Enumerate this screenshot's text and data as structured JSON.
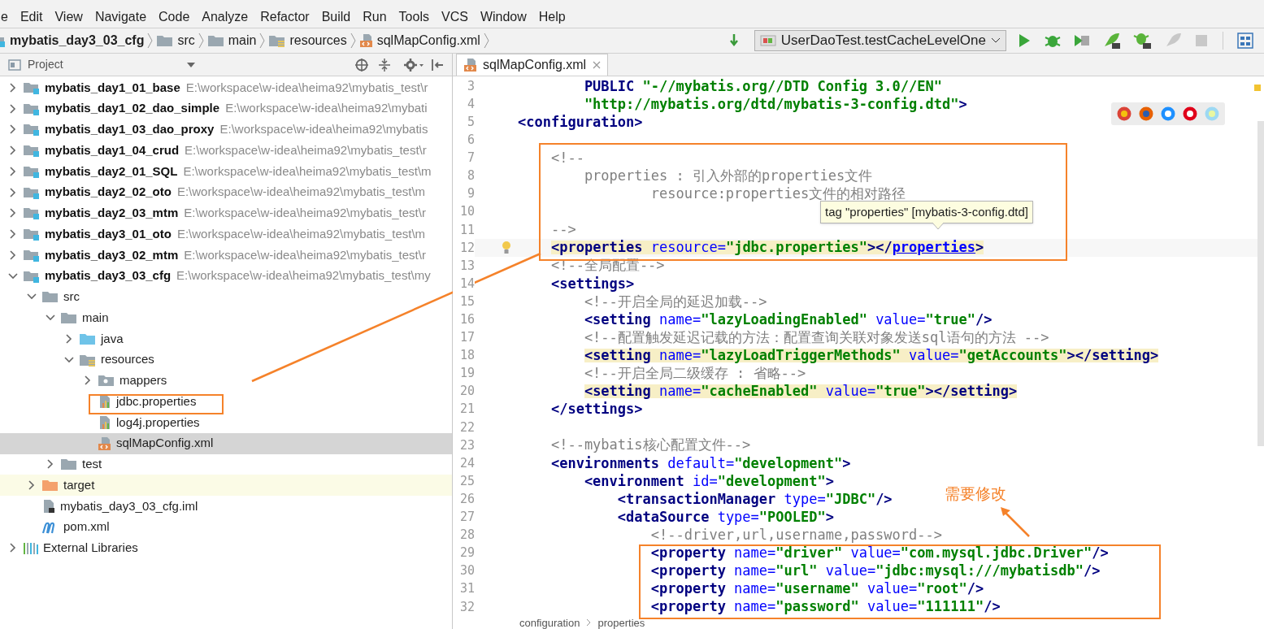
{
  "menu": [
    "e",
    "Edit",
    "View",
    "Navigate",
    "Code",
    "Analyze",
    "Refactor",
    "Build",
    "Run",
    "Tools",
    "VCS",
    "Window",
    "Help"
  ],
  "breadcrumbs": [
    {
      "label": "mybatis_day3_03_cfg",
      "kind": "module"
    },
    {
      "label": "src",
      "kind": "folder"
    },
    {
      "label": "main",
      "kind": "folder"
    },
    {
      "label": "resources",
      "kind": "resources-folder"
    },
    {
      "label": "sqlMapConfig.xml",
      "kind": "xml"
    }
  ],
  "run_config": "UserDaoTest.testCacheLevelOne",
  "project_panel": {
    "title": "Project",
    "tree": [
      {
        "label": "mybatis_day1_01_base",
        "path": "E:\\workspace\\w-idea\\heima92\\mybatis_test\\r",
        "kind": "module",
        "expanded": false,
        "selected": false
      },
      {
        "label": "mybatis_day1_02_dao_simple",
        "path": "E:\\workspace\\w-idea\\heima92\\mybati",
        "kind": "module",
        "expanded": false,
        "selected": false
      },
      {
        "label": "mybatis_day1_03_dao_proxy",
        "path": "E:\\workspace\\w-idea\\heima92\\mybatis",
        "kind": "module",
        "expanded": false,
        "selected": false
      },
      {
        "label": "mybatis_day1_04_crud",
        "path": "E:\\workspace\\w-idea\\heima92\\mybatis_test\\r",
        "kind": "module",
        "expanded": false,
        "selected": false
      },
      {
        "label": "mybatis_day2_01_SQL",
        "path": "E:\\workspace\\w-idea\\heima92\\mybatis_test\\m",
        "kind": "module",
        "expanded": false,
        "selected": false
      },
      {
        "label": "mybatis_day2_02_oto",
        "path": "E:\\workspace\\w-idea\\heima92\\mybatis_test\\m",
        "kind": "module",
        "expanded": false,
        "selected": false
      },
      {
        "label": "mybatis_day2_03_mtm",
        "path": "E:\\workspace\\w-idea\\heima92\\mybatis_test\\r",
        "kind": "module",
        "expanded": false,
        "selected": false
      },
      {
        "label": "mybatis_day3_01_oto",
        "path": "E:\\workspace\\w-idea\\heima92\\mybatis_test\\m",
        "kind": "module",
        "expanded": false,
        "selected": false
      },
      {
        "label": "mybatis_day3_02_mtm",
        "path": "E:\\workspace\\w-idea\\heima92\\mybatis_test\\r",
        "kind": "module",
        "expanded": false,
        "selected": false
      },
      {
        "label": "mybatis_day3_03_cfg",
        "path": "E:\\workspace\\w-idea\\heima92\\mybatis_test\\my",
        "kind": "module",
        "expanded": true,
        "selected": false,
        "children": [
          {
            "label": "src",
            "kind": "folder",
            "expanded": true,
            "selected": false,
            "children": [
              {
                "label": "main",
                "kind": "folder",
                "expanded": true,
                "selected": false,
                "children": [
                  {
                    "label": "java",
                    "kind": "source-folder",
                    "expanded": false,
                    "selected": false
                  },
                  {
                    "label": "resources",
                    "kind": "resources-folder",
                    "expanded": true,
                    "selected": false,
                    "children": [
                      {
                        "label": "mappers",
                        "kind": "package-folder",
                        "expanded": false,
                        "selected": false
                      },
                      {
                        "label": "jdbc.properties",
                        "kind": "properties",
                        "selected": false
                      },
                      {
                        "label": "log4j.properties",
                        "kind": "properties",
                        "selected": false
                      },
                      {
                        "label": "sqlMapConfig.xml",
                        "kind": "xml",
                        "selected": true
                      }
                    ]
                  }
                ]
              },
              {
                "label": "test",
                "kind": "folder",
                "expanded": false,
                "selected": false
              }
            ]
          },
          {
            "label": "target",
            "kind": "excluded-folder",
            "expanded": false,
            "selected": false
          },
          {
            "label": "mybatis_day3_03_cfg.iml",
            "kind": "iml",
            "selected": false
          },
          {
            "label": "pom.xml",
            "kind": "maven",
            "selected": false
          }
        ]
      },
      {
        "label": "External Libraries",
        "kind": "libraries",
        "expanded": false,
        "selected": false
      }
    ]
  },
  "editor": {
    "tabs": [
      {
        "label": "sqlMapConfig.xml",
        "selected": true
      }
    ],
    "lines": [
      {
        "num": "3",
        "tokens": [
          {
            "text": "        PUBLIC",
            "kind": "tag"
          },
          {
            "text": " \"-//mybatis.org//DTD Config 3.0//EN\"",
            "kind": "value"
          }
        ]
      },
      {
        "num": "4",
        "tokens": [
          {
            "text": "        \"http://mybatis.org/dtd/mybatis-3-config.dtd\"",
            "kind": "value"
          },
          {
            "text": ">",
            "kind": "tag"
          }
        ]
      },
      {
        "num": "5",
        "tokens": [
          {
            "text": "<configuration>",
            "kind": "tag"
          }
        ]
      },
      {
        "num": "6"
      },
      {
        "num": "7",
        "tokens": [
          {
            "text": "    <!--",
            "kind": "comment"
          }
        ]
      },
      {
        "num": "8",
        "tokens": [
          {
            "text": "        properties : 引入外部的properties文件",
            "kind": "comment"
          }
        ]
      },
      {
        "num": "9",
        "tokens": [
          {
            "text": "                resource:properties文件的相对路径",
            "kind": "comment"
          }
        ]
      },
      {
        "num": "10"
      },
      {
        "num": "11",
        "tokens": [
          {
            "text": "    -->",
            "kind": "comment"
          }
        ]
      },
      {
        "num": "12",
        "current": true,
        "bulb": true,
        "tokens": [
          {
            "text": "    <properties",
            "kind": "tag",
            "hl": true
          },
          {
            "text": " resource=",
            "kind": "attr",
            "hl": true
          },
          {
            "text": "\"jdbc.properties\"",
            "kind": "value",
            "hl": true
          },
          {
            "text": "></",
            "kind": "tag",
            "hl": true
          },
          {
            "text": "properties",
            "kind": "link",
            "hl": true
          },
          {
            "text": ">",
            "kind": "tag",
            "hl": true
          }
        ]
      },
      {
        "num": "13",
        "tokens": [
          {
            "text": "    <!--全局配置-->",
            "kind": "comment"
          }
        ]
      },
      {
        "num": "14",
        "tokens": [
          {
            "text": "    <settings>",
            "kind": "tag"
          }
        ]
      },
      {
        "num": "15",
        "tokens": [
          {
            "text": "        <!--开启全局的延迟加载-->",
            "kind": "comment"
          }
        ]
      },
      {
        "num": "16",
        "tokens": [
          {
            "text": "        <setting",
            "kind": "tag"
          },
          {
            "text": " name=",
            "kind": "attr"
          },
          {
            "text": "\"lazyLoadingEnabled\"",
            "kind": "value"
          },
          {
            "text": " value=",
            "kind": "attr"
          },
          {
            "text": "\"true\"",
            "kind": "value"
          },
          {
            "text": "/>",
            "kind": "tag"
          }
        ]
      },
      {
        "num": "17",
        "tokens": [
          {
            "text": "        <!--配置触发延迟记载的方法：配置查询关联对象发送sql语句的方法 -->",
            "kind": "comment"
          }
        ]
      },
      {
        "num": "18",
        "tokens": [
          {
            "text": "        <setting",
            "kind": "tag",
            "hl": true
          },
          {
            "text": " name=",
            "kind": "attr",
            "hl": true
          },
          {
            "text": "\"lazyLoadTriggerMethods\"",
            "kind": "value",
            "hl": true
          },
          {
            "text": " value=",
            "kind": "attr",
            "hl": true
          },
          {
            "text": "\"getAccounts\"",
            "kind": "value",
            "hl": true
          },
          {
            "text": "></setting>",
            "kind": "tag",
            "hl": true
          }
        ]
      },
      {
        "num": "19",
        "tokens": [
          {
            "text": "        <!--开启全局二级缓存 : 省略-->",
            "kind": "comment"
          }
        ]
      },
      {
        "num": "20",
        "tokens": [
          {
            "text": "        <setting",
            "kind": "tag",
            "hl": true
          },
          {
            "text": " name=",
            "kind": "attr",
            "hl": true
          },
          {
            "text": "\"cacheEnabled\"",
            "kind": "value",
            "hl": true
          },
          {
            "text": " value=",
            "kind": "attr",
            "hl": true
          },
          {
            "text": "\"true\"",
            "kind": "value",
            "hl": true
          },
          {
            "text": "></setting>",
            "kind": "tag",
            "hl": true
          }
        ]
      },
      {
        "num": "21",
        "tokens": [
          {
            "text": "    </settings>",
            "kind": "tag"
          }
        ]
      },
      {
        "num": "22"
      },
      {
        "num": "23",
        "tokens": [
          {
            "text": "    <!--mybatis核心配置文件-->",
            "kind": "comment"
          }
        ]
      },
      {
        "num": "24",
        "tokens": [
          {
            "text": "    <environments",
            "kind": "tag"
          },
          {
            "text": " default=",
            "kind": "attr"
          },
          {
            "text": "\"development\"",
            "kind": "value"
          },
          {
            "text": ">",
            "kind": "tag"
          }
        ]
      },
      {
        "num": "25",
        "tokens": [
          {
            "text": "        <environment",
            "kind": "tag"
          },
          {
            "text": " id=",
            "kind": "attr"
          },
          {
            "text": "\"development\"",
            "kind": "value"
          },
          {
            "text": ">",
            "kind": "tag"
          }
        ]
      },
      {
        "num": "26",
        "tokens": [
          {
            "text": "            <transactionManager",
            "kind": "tag"
          },
          {
            "text": " type=",
            "kind": "attr"
          },
          {
            "text": "\"JDBC\"",
            "kind": "value"
          },
          {
            "text": "/>",
            "kind": "tag"
          }
        ]
      },
      {
        "num": "27",
        "tokens": [
          {
            "text": "            <dataSource",
            "kind": "tag"
          },
          {
            "text": " type=",
            "kind": "attr"
          },
          {
            "text": "\"POOLED\"",
            "kind": "value"
          },
          {
            "text": ">",
            "kind": "tag"
          }
        ]
      },
      {
        "num": "28",
        "tokens": [
          {
            "text": "                <!--driver,url,username,password-->",
            "kind": "comment"
          }
        ]
      },
      {
        "num": "29",
        "tokens": [
          {
            "text": "                <property",
            "kind": "tag"
          },
          {
            "text": " name=",
            "kind": "attr"
          },
          {
            "text": "\"driver\"",
            "kind": "value"
          },
          {
            "text": " value=",
            "kind": "attr"
          },
          {
            "text": "\"com.mysql.jdbc.Driver\"",
            "kind": "value"
          },
          {
            "text": "/>",
            "kind": "tag"
          }
        ]
      },
      {
        "num": "30",
        "tokens": [
          {
            "text": "                <property",
            "kind": "tag"
          },
          {
            "text": " name=",
            "kind": "attr"
          },
          {
            "text": "\"url\"",
            "kind": "value"
          },
          {
            "text": " value=",
            "kind": "attr"
          },
          {
            "text": "\"jdbc:mysql:///mybatisdb\"",
            "kind": "value"
          },
          {
            "text": "/>",
            "kind": "tag"
          }
        ]
      },
      {
        "num": "31",
        "tokens": [
          {
            "text": "                <property",
            "kind": "tag"
          },
          {
            "text": " name=",
            "kind": "attr"
          },
          {
            "text": "\"username\"",
            "kind": "value"
          },
          {
            "text": " value=",
            "kind": "attr"
          },
          {
            "text": "\"root\"",
            "kind": "value"
          },
          {
            "text": "/>",
            "kind": "tag"
          }
        ]
      },
      {
        "num": "32",
        "tokens": [
          {
            "text": "                <property",
            "kind": "tag"
          },
          {
            "text": " name=",
            "kind": "attr"
          },
          {
            "text": "\"password\"",
            "kind": "value"
          },
          {
            "text": " value=",
            "kind": "attr"
          },
          {
            "text": "\"111111\"",
            "kind": "value"
          },
          {
            "text": "/>",
            "kind": "tag"
          }
        ]
      }
    ],
    "tooltip": "tag \"properties\" [mybatis-3-config.dtd]",
    "breadcrumbs": [
      "configuration",
      "properties"
    ]
  },
  "annotation": {
    "label": "需要修改"
  }
}
